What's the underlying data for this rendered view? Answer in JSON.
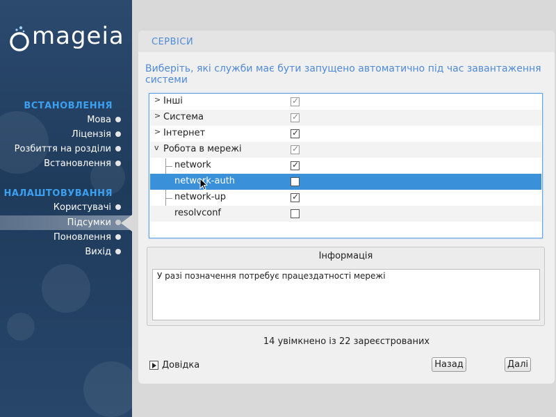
{
  "logo": {
    "text": "mageia"
  },
  "sidebar": {
    "sections": [
      {
        "heading": "ВСТАНОВЛЕННЯ",
        "items": [
          {
            "label": "Мова"
          },
          {
            "label": "Ліцензія"
          },
          {
            "label": "Розбиття на розділи"
          },
          {
            "label": "Встановлення"
          }
        ]
      },
      {
        "heading": "НАЛАШТОВУВАННЯ",
        "items": [
          {
            "label": "Користувачі"
          },
          {
            "label": "Підсумки",
            "active": true
          },
          {
            "label": "Поновлення"
          },
          {
            "label": "Вихід"
          }
        ]
      }
    ]
  },
  "page": {
    "title": "СЕРВІСИ",
    "question": "Виберіть, які служби має бути запущено автоматично під час завантаження системи"
  },
  "tree": {
    "rows": [
      {
        "label": "Інші",
        "level": 0,
        "expander": ">",
        "checked": true,
        "dim": true
      },
      {
        "label": "Система",
        "level": 0,
        "expander": ">",
        "checked": true,
        "dim": true
      },
      {
        "label": "Інтернет",
        "level": 0,
        "expander": ">",
        "checked": true,
        "dim": false
      },
      {
        "label": "Робота в мережі",
        "level": 0,
        "expander": "v",
        "checked": true,
        "dim": true
      },
      {
        "label": "network",
        "level": 1,
        "checked": true,
        "dim": false
      },
      {
        "label": "network-auth",
        "level": 1,
        "checked": false,
        "selected": true
      },
      {
        "label": "network-up",
        "level": 1,
        "checked": true,
        "dim": false
      },
      {
        "label": "resolvconf",
        "level": 1,
        "checked": false
      }
    ]
  },
  "info": {
    "title": "Інформація",
    "text": "У разі позначення потребує працездатності мережі"
  },
  "status": "14 увімкнено із 22 зареєстрованих",
  "buttons": {
    "help": "Довідка",
    "back": "Назад",
    "next": "Далі"
  },
  "icons": {
    "tick": "✓",
    "expander_closed": ">",
    "expander_open": "v"
  },
  "colors": {
    "accent": "#4f8ad9",
    "sidebar_heading": "#3ba0ef",
    "selection": "#3b91d9"
  }
}
